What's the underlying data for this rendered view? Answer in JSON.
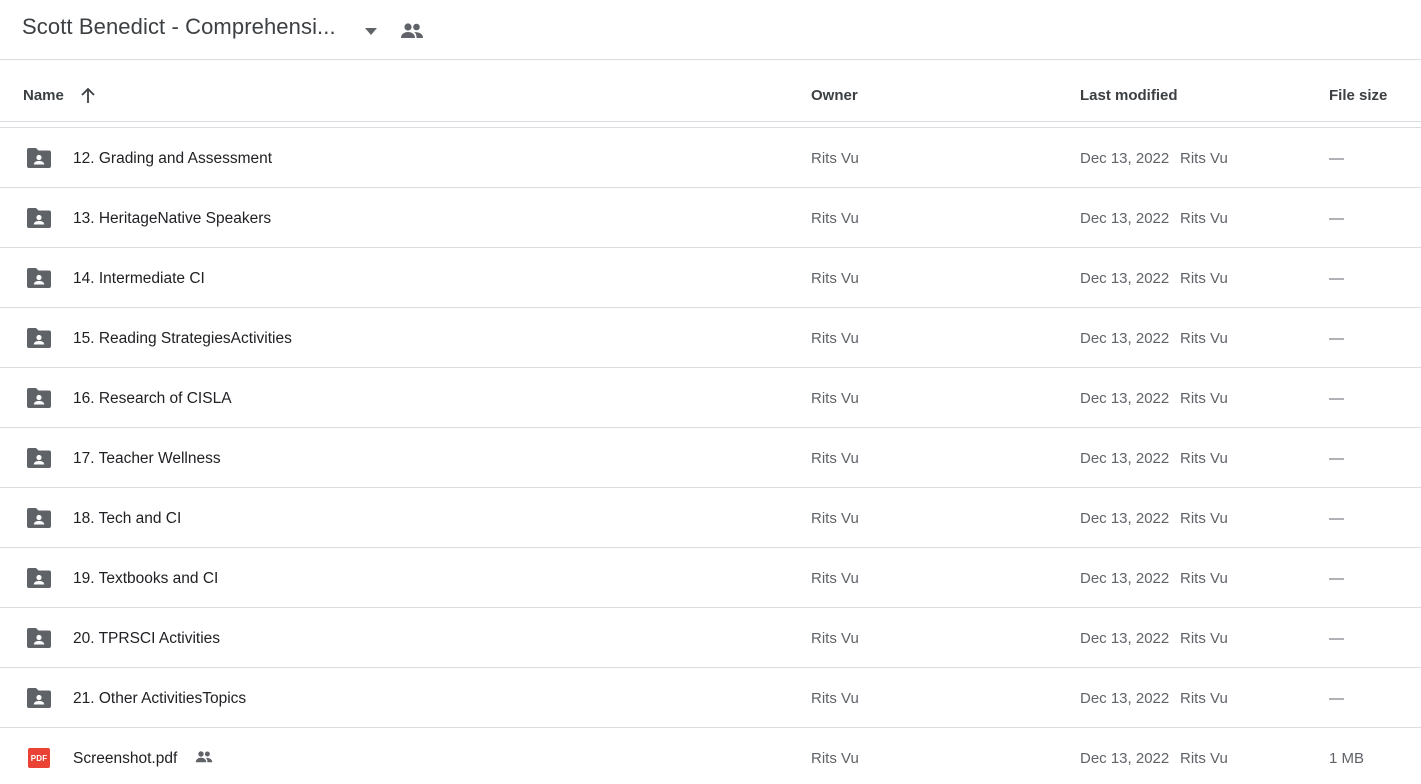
{
  "header": {
    "title": "Scott Benedict - Comprehensi...",
    "caret_icon": "arrow-drop-down-icon",
    "shared_icon": "people-icon"
  },
  "columns": {
    "name": "Name",
    "owner": "Owner",
    "last_modified": "Last modified",
    "file_size": "File size",
    "sort_icon": "arrow-upward-icon"
  },
  "rows": [
    {
      "icon": "shared-folder-icon",
      "name": "12. Grading and Assessment",
      "owner": "Rits Vu",
      "modified": "Dec 13, 2022",
      "modified_by": "Rits Vu",
      "size": "—"
    },
    {
      "icon": "shared-folder-icon",
      "name": "13. HeritageNative Speakers",
      "owner": "Rits Vu",
      "modified": "Dec 13, 2022",
      "modified_by": "Rits Vu",
      "size": "—"
    },
    {
      "icon": "shared-folder-icon",
      "name": "14. Intermediate CI",
      "owner": "Rits Vu",
      "modified": "Dec 13, 2022",
      "modified_by": "Rits Vu",
      "size": "—"
    },
    {
      "icon": "shared-folder-icon",
      "name": "15. Reading StrategiesActivities",
      "owner": "Rits Vu",
      "modified": "Dec 13, 2022",
      "modified_by": "Rits Vu",
      "size": "—"
    },
    {
      "icon": "shared-folder-icon",
      "name": "16. Research of CISLA",
      "owner": "Rits Vu",
      "modified": "Dec 13, 2022",
      "modified_by": "Rits Vu",
      "size": "—"
    },
    {
      "icon": "shared-folder-icon",
      "name": "17. Teacher Wellness",
      "owner": "Rits Vu",
      "modified": "Dec 13, 2022",
      "modified_by": "Rits Vu",
      "size": "—"
    },
    {
      "icon": "shared-folder-icon",
      "name": "18. Tech and CI",
      "owner": "Rits Vu",
      "modified": "Dec 13, 2022",
      "modified_by": "Rits Vu",
      "size": "—"
    },
    {
      "icon": "shared-folder-icon",
      "name": "19. Textbooks and CI",
      "owner": "Rits Vu",
      "modified": "Dec 13, 2022",
      "modified_by": "Rits Vu",
      "size": "—"
    },
    {
      "icon": "shared-folder-icon",
      "name": "20. TPRSCI Activities",
      "owner": "Rits Vu",
      "modified": "Dec 13, 2022",
      "modified_by": "Rits Vu",
      "size": "—"
    },
    {
      "icon": "shared-folder-icon",
      "name": "21. Other ActivitiesTopics",
      "owner": "Rits Vu",
      "modified": "Dec 13, 2022",
      "modified_by": "Rits Vu",
      "size": "—"
    },
    {
      "icon": "pdf-icon",
      "icon_label": "PDF",
      "name": "Screenshot.pdf",
      "shared": true,
      "owner": "Rits Vu",
      "modified": "Dec 13, 2022",
      "modified_by": "Rits Vu",
      "size": "1 MB"
    }
  ],
  "colors": {
    "text_primary": "#202124",
    "text_secondary": "#5f6368",
    "divider": "#dadce0",
    "folder_icon": "#5f6368",
    "pdf_red": "#ea4335"
  }
}
